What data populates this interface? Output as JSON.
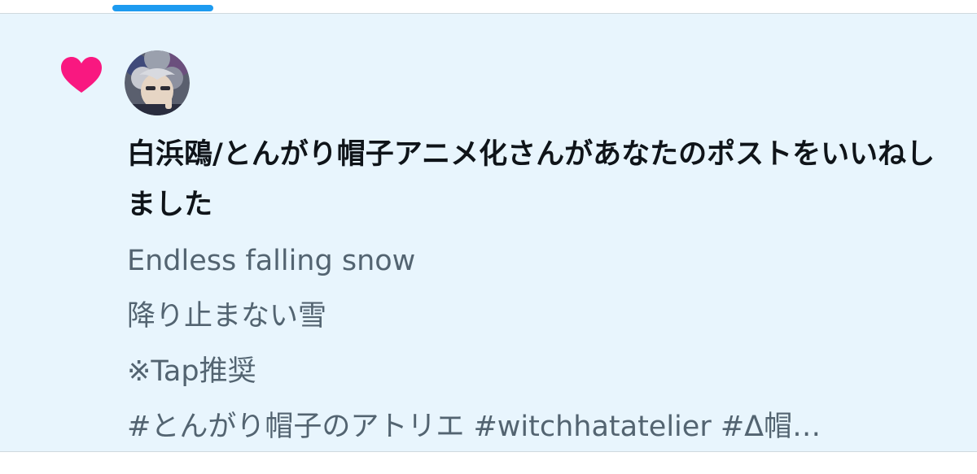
{
  "notification": {
    "type_icon": "heart-icon",
    "avatar_icon": "avatar-image",
    "headline": "白浜鴎/とんがり帽子アニメ化さんがあなたのポストをいいねしました",
    "post_lines": [
      "Endless falling snow",
      "降り止まない雪",
      "※Tap推奨",
      "#とんがり帽子のアトリエ #witchhatatelier #Δ帽…"
    ]
  },
  "colors": {
    "accent": "#1d9bf0",
    "like": "#f91880",
    "highlight_bg": "#e8f5fd",
    "primary_text": "#0f1419",
    "secondary_text": "#536471"
  }
}
